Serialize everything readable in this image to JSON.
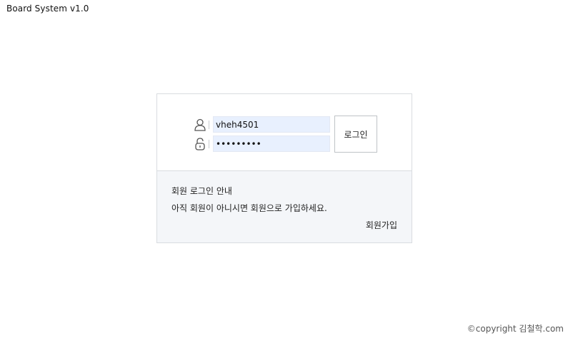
{
  "app": {
    "title": "Board System v1.0"
  },
  "login": {
    "user_id_value": "vheh4501",
    "password_value": "password1",
    "login_button_label": "로그인"
  },
  "info": {
    "title": "회원 로그인 안내",
    "text": "아직 회원이 아니시면 회원으로 가입하세요.",
    "signup_label": "회원가입"
  },
  "icons": {
    "user": "user-icon",
    "lock": "lock-icon"
  },
  "footer": {
    "copyright": "©copyright 김철학.com"
  },
  "colors": {
    "input_autofill_bg": "#e8f0fe",
    "panel_bg": "#f4f6f9",
    "border": "#d9dce0"
  }
}
